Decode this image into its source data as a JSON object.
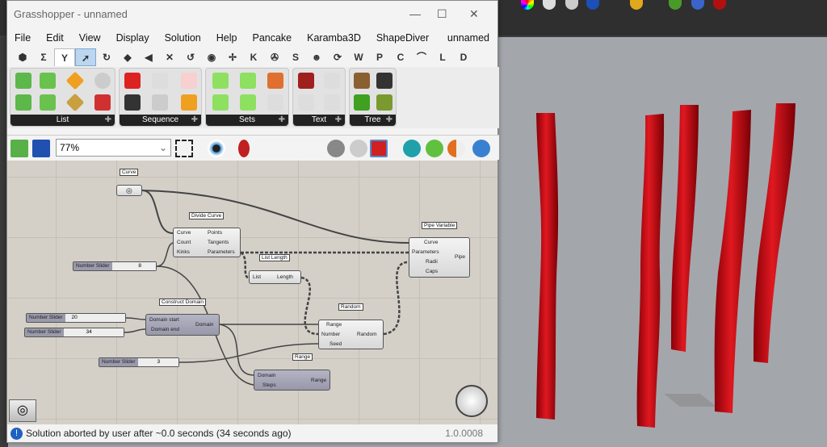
{
  "window": {
    "title": "Grasshopper - unnamed",
    "doc_name": "unnamed"
  },
  "menu": [
    "File",
    "Edit",
    "View",
    "Display",
    "Solution",
    "Help",
    "Pancake",
    "Karamba3D",
    "ShapeDiver"
  ],
  "tabs": [
    "⬢",
    "Σ",
    "Y",
    "➚",
    "↻",
    "◆",
    "◀",
    "✕",
    "↺",
    "◉",
    "✢",
    "K",
    "✇",
    "S",
    "☻",
    "⟳",
    "W",
    "P",
    "C",
    "⌒",
    "L",
    "D"
  ],
  "ribbon_groups": [
    {
      "label": "List"
    },
    {
      "label": "Sequence"
    },
    {
      "label": "Sets"
    },
    {
      "label": "Text"
    },
    {
      "label": "Tree"
    }
  ],
  "toolbar": {
    "zoom": "77%"
  },
  "canvas": {
    "curve": {
      "label": "Curve"
    },
    "divide": {
      "label": "Divide Curve",
      "inputs": [
        "Curve",
        "Count",
        "Kinks"
      ],
      "outputs": [
        "Points",
        "Tangents",
        "Parameters"
      ]
    },
    "list_length": {
      "label": "List Length",
      "input": "List",
      "output": "Length"
    },
    "pipe": {
      "label": "Pipe Variable",
      "inputs": [
        "Curve",
        "Parameters",
        "Radii",
        "Caps"
      ],
      "output": "Pipe"
    },
    "domain": {
      "label": "Construct Domain",
      "inputs": [
        "Domain start",
        "Domain end"
      ],
      "output": "Domain"
    },
    "random": {
      "label": "Random",
      "inputs": [
        "Range",
        "Number",
        "Seed"
      ],
      "output": "Random"
    },
    "range": {
      "label": "Range",
      "inputs": [
        "Domain",
        "Steps"
      ],
      "output": "Range"
    },
    "sliders": [
      {
        "name": "Number Slider",
        "value": "8"
      },
      {
        "name": "Number Slider",
        "value": "20"
      },
      {
        "name": "Number Slider",
        "value": "34"
      },
      {
        "name": "Number Slider",
        "value": "3"
      }
    ]
  },
  "status": {
    "message": "Solution aborted by user after ~0.0 seconds (34 seconds ago)",
    "version": "1.0.0008"
  },
  "colors": {
    "pipe": "#c8101a",
    "canvas": "#d4d0c8"
  }
}
